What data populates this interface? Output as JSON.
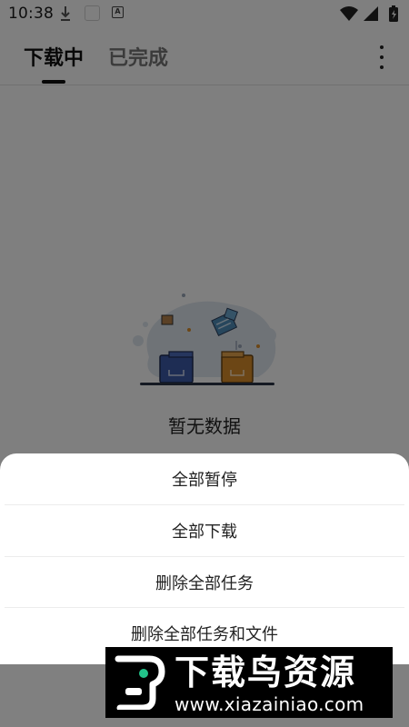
{
  "status_bar": {
    "time": "10:38",
    "left_icons": [
      "download-icon",
      "app-square-icon",
      "a-badge-icon"
    ],
    "right_icons": [
      "wifi-icon",
      "signal-icon",
      "battery-icon"
    ]
  },
  "header": {
    "tabs": [
      {
        "label": "下载中",
        "active": true
      },
      {
        "label": "已完成",
        "active": false
      }
    ],
    "menu_icon": "more-vertical-icon"
  },
  "empty_state": {
    "illustration": "folders-illustration",
    "message": "暂无数据"
  },
  "bottom_sheet": {
    "items": [
      {
        "label": "全部暂停"
      },
      {
        "label": "全部下载"
      },
      {
        "label": "删除全部任务"
      },
      {
        "label": "删除全部任务和文件"
      }
    ]
  },
  "watermark": {
    "title": "下载鸟资源",
    "url": "www.xiazainiao.com",
    "logo": "xiazainiao-logo"
  },
  "colors": {
    "scrim": "#808080",
    "sheet": "#ffffff",
    "folder_blue": "#3d5ba8",
    "folder_orange": "#d98d2b",
    "watermark_bg": "#000000",
    "logo_green": "#22c38a"
  }
}
